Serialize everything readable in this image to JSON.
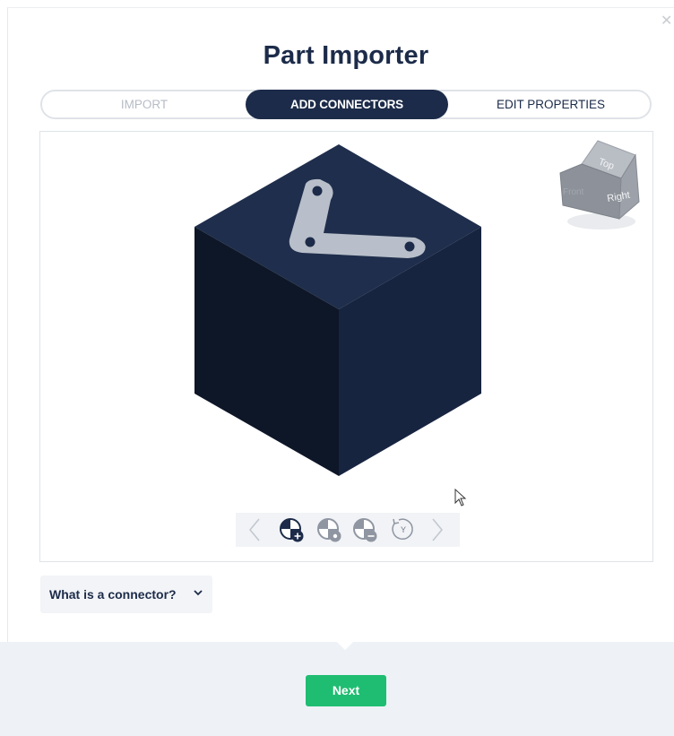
{
  "dialog": {
    "title": "Part Importer",
    "close_icon": "close-icon"
  },
  "stepper": {
    "steps": [
      {
        "label": "IMPORT",
        "state": "done"
      },
      {
        "label": "ADD CONNECTORS",
        "state": "active"
      },
      {
        "label": "EDIT PROPERTIES",
        "state": "pending"
      }
    ]
  },
  "viewer": {
    "view_cube": {
      "top_label": "Top",
      "right_label": "Right",
      "front_label": "Front"
    },
    "model": {
      "body_color": "#1c2b49",
      "bracket_color": "#b8bfca"
    },
    "toolbar": [
      {
        "name": "prev-connector",
        "icon": "chevron-left-icon"
      },
      {
        "name": "add-connector",
        "icon": "add-connector-icon"
      },
      {
        "name": "connector-settings",
        "icon": "connector-settings-icon"
      },
      {
        "name": "remove-connector",
        "icon": "remove-connector-icon"
      },
      {
        "name": "rotate-y",
        "icon": "rotate-y-icon",
        "label": "Y"
      },
      {
        "name": "next-connector",
        "icon": "chevron-right-icon"
      }
    ]
  },
  "help": {
    "label": "What is a connector?",
    "icon": "chevron-down-icon"
  },
  "footer": {
    "next_label": "Next",
    "accent": "#1fbd72"
  },
  "colors": {
    "primary": "#1c2b49",
    "muted": "#b6bcc6",
    "border": "#dfe3e8",
    "footer_bg": "#eef2f7"
  }
}
